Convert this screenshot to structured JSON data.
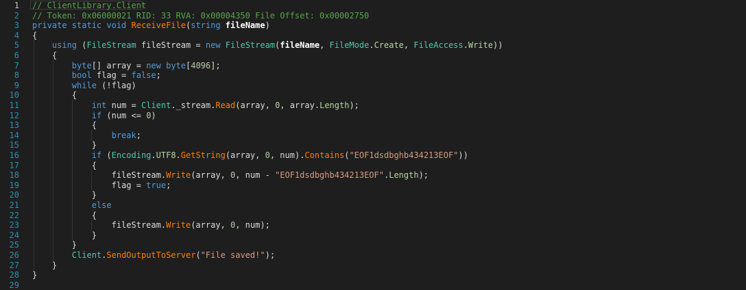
{
  "editor": {
    "current_line": 1,
    "colors": {
      "background": "#1e1e1e",
      "line_number": "#2b91af",
      "plain": "#dcdcdc",
      "keyword": "#569cd6",
      "type": "#4ec9b0",
      "method": "#ff8000",
      "string": "#d69d85",
      "number": "#b5cea8",
      "comment": "#57a64a",
      "member": "#b8d7a3"
    },
    "lines": [
      {
        "number": "1",
        "tokens": [
          {
            "t": "// ClientLibrary.Client",
            "c": "com"
          }
        ]
      },
      {
        "number": "2",
        "tokens": [
          {
            "t": "// Token: 0x06000021 RID: 33 RVA: 0x00004350 File Offset: 0x00002750",
            "c": "com"
          }
        ]
      },
      {
        "number": "3",
        "tokens": [
          {
            "t": "private static void ",
            "c": "kw"
          },
          {
            "t": "ReceiveFile",
            "c": "meth"
          },
          {
            "t": "(",
            "c": "plain"
          },
          {
            "t": "string ",
            "c": "kw"
          },
          {
            "t": "fileName",
            "c": "bold"
          },
          {
            "t": ")",
            "c": "plain"
          }
        ]
      },
      {
        "number": "4",
        "tokens": [
          {
            "t": "{",
            "c": "plain"
          }
        ]
      },
      {
        "number": "5",
        "tokens": [
          {
            "t": "    ",
            "c": "plain"
          },
          {
            "t": "using",
            "c": "kw"
          },
          {
            "t": " (",
            "c": "plain"
          },
          {
            "t": "FileStream",
            "c": "type"
          },
          {
            "t": " fileStream = ",
            "c": "plain"
          },
          {
            "t": "new ",
            "c": "kw"
          },
          {
            "t": "FileStream",
            "c": "type"
          },
          {
            "t": "(",
            "c": "plain"
          },
          {
            "t": "fileName",
            "c": "bold"
          },
          {
            "t": ", ",
            "c": "plain"
          },
          {
            "t": "FileMode",
            "c": "type"
          },
          {
            "t": ".",
            "c": "plain"
          },
          {
            "t": "Create",
            "c": "prop"
          },
          {
            "t": ", ",
            "c": "plain"
          },
          {
            "t": "FileAccess",
            "c": "type"
          },
          {
            "t": ".",
            "c": "plain"
          },
          {
            "t": "Write",
            "c": "prop"
          },
          {
            "t": "))",
            "c": "plain"
          }
        ]
      },
      {
        "number": "6",
        "tokens": [
          {
            "t": "    {",
            "c": "plain"
          }
        ]
      },
      {
        "number": "7",
        "tokens": [
          {
            "t": "        ",
            "c": "plain"
          },
          {
            "t": "byte",
            "c": "kw"
          },
          {
            "t": "[] array = ",
            "c": "plain"
          },
          {
            "t": "new ",
            "c": "kw"
          },
          {
            "t": "byte",
            "c": "kw"
          },
          {
            "t": "[",
            "c": "plain"
          },
          {
            "t": "4096",
            "c": "num"
          },
          {
            "t": "];",
            "c": "plain"
          }
        ]
      },
      {
        "number": "8",
        "tokens": [
          {
            "t": "        ",
            "c": "plain"
          },
          {
            "t": "bool",
            "c": "kw"
          },
          {
            "t": " flag = ",
            "c": "plain"
          },
          {
            "t": "false",
            "c": "kw"
          },
          {
            "t": ";",
            "c": "plain"
          }
        ]
      },
      {
        "number": "9",
        "tokens": [
          {
            "t": "        ",
            "c": "plain"
          },
          {
            "t": "while",
            "c": "kw"
          },
          {
            "t": " (!flag)",
            "c": "plain"
          }
        ]
      },
      {
        "number": "10",
        "tokens": [
          {
            "t": "        {",
            "c": "plain"
          }
        ]
      },
      {
        "number": "11",
        "tokens": [
          {
            "t": "            ",
            "c": "plain"
          },
          {
            "t": "int",
            "c": "kw"
          },
          {
            "t": " num = ",
            "c": "plain"
          },
          {
            "t": "Client",
            "c": "type"
          },
          {
            "t": "._stream.",
            "c": "plain"
          },
          {
            "t": "Read",
            "c": "meth"
          },
          {
            "t": "(array, ",
            "c": "plain"
          },
          {
            "t": "0",
            "c": "num"
          },
          {
            "t": ", array.",
            "c": "plain"
          },
          {
            "t": "Length",
            "c": "prop"
          },
          {
            "t": ");",
            "c": "plain"
          }
        ]
      },
      {
        "number": "12",
        "tokens": [
          {
            "t": "            ",
            "c": "plain"
          },
          {
            "t": "if",
            "c": "kw"
          },
          {
            "t": " (num <= ",
            "c": "plain"
          },
          {
            "t": "0",
            "c": "num"
          },
          {
            "t": ")",
            "c": "plain"
          }
        ]
      },
      {
        "number": "13",
        "tokens": [
          {
            "t": "            {",
            "c": "plain"
          }
        ]
      },
      {
        "number": "14",
        "tokens": [
          {
            "t": "                ",
            "c": "plain"
          },
          {
            "t": "break",
            "c": "kw"
          },
          {
            "t": ";",
            "c": "plain"
          }
        ]
      },
      {
        "number": "15",
        "tokens": [
          {
            "t": "            }",
            "c": "plain"
          }
        ]
      },
      {
        "number": "16",
        "tokens": [
          {
            "t": "            ",
            "c": "plain"
          },
          {
            "t": "if",
            "c": "kw"
          },
          {
            "t": " (",
            "c": "plain"
          },
          {
            "t": "Encoding",
            "c": "type"
          },
          {
            "t": ".",
            "c": "plain"
          },
          {
            "t": "UTF8",
            "c": "prop"
          },
          {
            "t": ".",
            "c": "plain"
          },
          {
            "t": "GetString",
            "c": "meth"
          },
          {
            "t": "(array, ",
            "c": "plain"
          },
          {
            "t": "0",
            "c": "num"
          },
          {
            "t": ", num).",
            "c": "plain"
          },
          {
            "t": "Contains",
            "c": "meth"
          },
          {
            "t": "(",
            "c": "plain"
          },
          {
            "t": "\"EOF1dsdbghb434213EOF\"",
            "c": "str"
          },
          {
            "t": "))",
            "c": "plain"
          }
        ]
      },
      {
        "number": "17",
        "tokens": [
          {
            "t": "            {",
            "c": "plain"
          }
        ]
      },
      {
        "number": "18",
        "tokens": [
          {
            "t": "                fileStream.",
            "c": "plain"
          },
          {
            "t": "Write",
            "c": "meth"
          },
          {
            "t": "(array, ",
            "c": "plain"
          },
          {
            "t": "0",
            "c": "num"
          },
          {
            "t": ", num - ",
            "c": "plain"
          },
          {
            "t": "\"EOF1dsdbghb434213EOF\"",
            "c": "str"
          },
          {
            "t": ".",
            "c": "plain"
          },
          {
            "t": "Length",
            "c": "prop"
          },
          {
            "t": ");",
            "c": "plain"
          }
        ]
      },
      {
        "number": "19",
        "tokens": [
          {
            "t": "                flag = ",
            "c": "plain"
          },
          {
            "t": "true",
            "c": "kw"
          },
          {
            "t": ";",
            "c": "plain"
          }
        ]
      },
      {
        "number": "20",
        "tokens": [
          {
            "t": "            }",
            "c": "plain"
          }
        ]
      },
      {
        "number": "21",
        "tokens": [
          {
            "t": "            ",
            "c": "plain"
          },
          {
            "t": "else",
            "c": "kw"
          }
        ]
      },
      {
        "number": "22",
        "tokens": [
          {
            "t": "            {",
            "c": "plain"
          }
        ]
      },
      {
        "number": "23",
        "tokens": [
          {
            "t": "                fileStream.",
            "c": "plain"
          },
          {
            "t": "Write",
            "c": "meth"
          },
          {
            "t": "(array, ",
            "c": "plain"
          },
          {
            "t": "0",
            "c": "num"
          },
          {
            "t": ", num);",
            "c": "plain"
          }
        ]
      },
      {
        "number": "24",
        "tokens": [
          {
            "t": "            }",
            "c": "plain"
          }
        ]
      },
      {
        "number": "25",
        "tokens": [
          {
            "t": "        }",
            "c": "plain"
          }
        ]
      },
      {
        "number": "26",
        "tokens": [
          {
            "t": "        ",
            "c": "plain"
          },
          {
            "t": "Client",
            "c": "type"
          },
          {
            "t": ".",
            "c": "plain"
          },
          {
            "t": "SendOutputToServer",
            "c": "meth"
          },
          {
            "t": "(",
            "c": "plain"
          },
          {
            "t": "\"File saved!\"",
            "c": "str"
          },
          {
            "t": ");",
            "c": "plain"
          }
        ]
      },
      {
        "number": "27",
        "tokens": [
          {
            "t": "    }",
            "c": "plain"
          }
        ]
      },
      {
        "number": "28",
        "tokens": [
          {
            "t": "}",
            "c": "plain"
          }
        ]
      },
      {
        "number": "29",
        "tokens": []
      }
    ]
  }
}
